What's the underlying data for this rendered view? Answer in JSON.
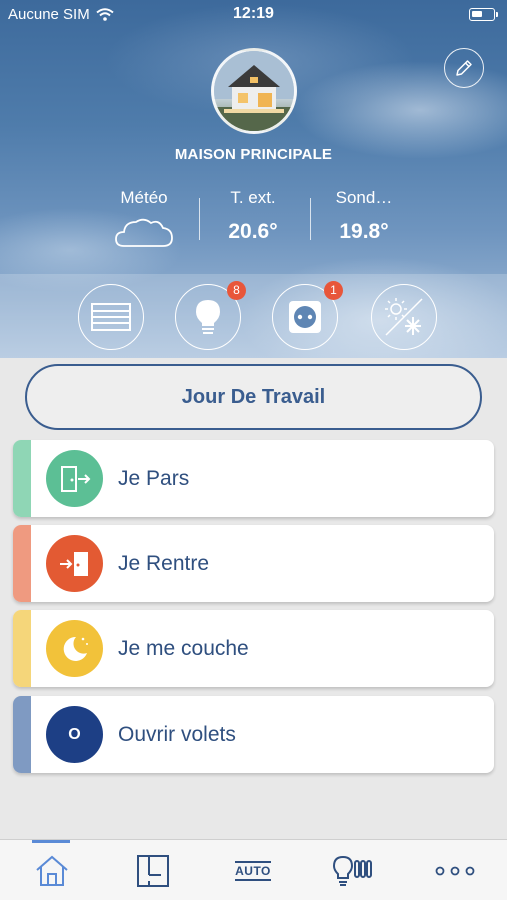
{
  "status_bar": {
    "carrier": "Aucune SIM",
    "time": "12:19"
  },
  "home": {
    "name": "MAISON PRINCIPALE"
  },
  "weather": [
    {
      "label": "Météo",
      "value": "",
      "icon": "cloud-icon"
    },
    {
      "label": "T. ext.",
      "value": "20.6°"
    },
    {
      "label": "Sond…",
      "value": "19.8°"
    }
  ],
  "categories": [
    {
      "name": "shutters",
      "icon": "shutter-icon",
      "badge": ""
    },
    {
      "name": "lights",
      "icon": "bulb-icon",
      "badge": "8"
    },
    {
      "name": "sockets",
      "icon": "socket-icon",
      "badge": "1"
    },
    {
      "name": "climate",
      "icon": "sun-snow-icon",
      "badge": ""
    }
  ],
  "mode": {
    "label": "Jour De Travail"
  },
  "scenarios": [
    {
      "label": "Je Pars",
      "icon": "door-exit-icon",
      "color": "#5cbf95",
      "stripe": "#8fd6b5"
    },
    {
      "label": "Je Rentre",
      "icon": "door-enter-icon",
      "color": "#e35a33",
      "stripe": "#ef9a80"
    },
    {
      "label": "Je me couche",
      "icon": "moon-icon",
      "color": "#f2c23a",
      "stripe": "#f5d67a"
    },
    {
      "label": "Ouvrir volets",
      "icon": "letter-o-icon",
      "icon_text": "O",
      "color": "#1d3f85",
      "stripe": "#7f9ac2"
    }
  ],
  "tabbar": {
    "items": [
      {
        "name": "home",
        "icon": "home-icon",
        "active": true
      },
      {
        "name": "rooms",
        "icon": "floorplan-icon"
      },
      {
        "name": "auto",
        "label": "AUTO"
      },
      {
        "name": "devices",
        "icon": "bulb-radiator-icon"
      },
      {
        "name": "more",
        "icon": "more-icon"
      }
    ]
  },
  "colors": {
    "accent": "#2f4f7f",
    "badge": "#e8563a",
    "active_tab": "#5a8ad6"
  }
}
